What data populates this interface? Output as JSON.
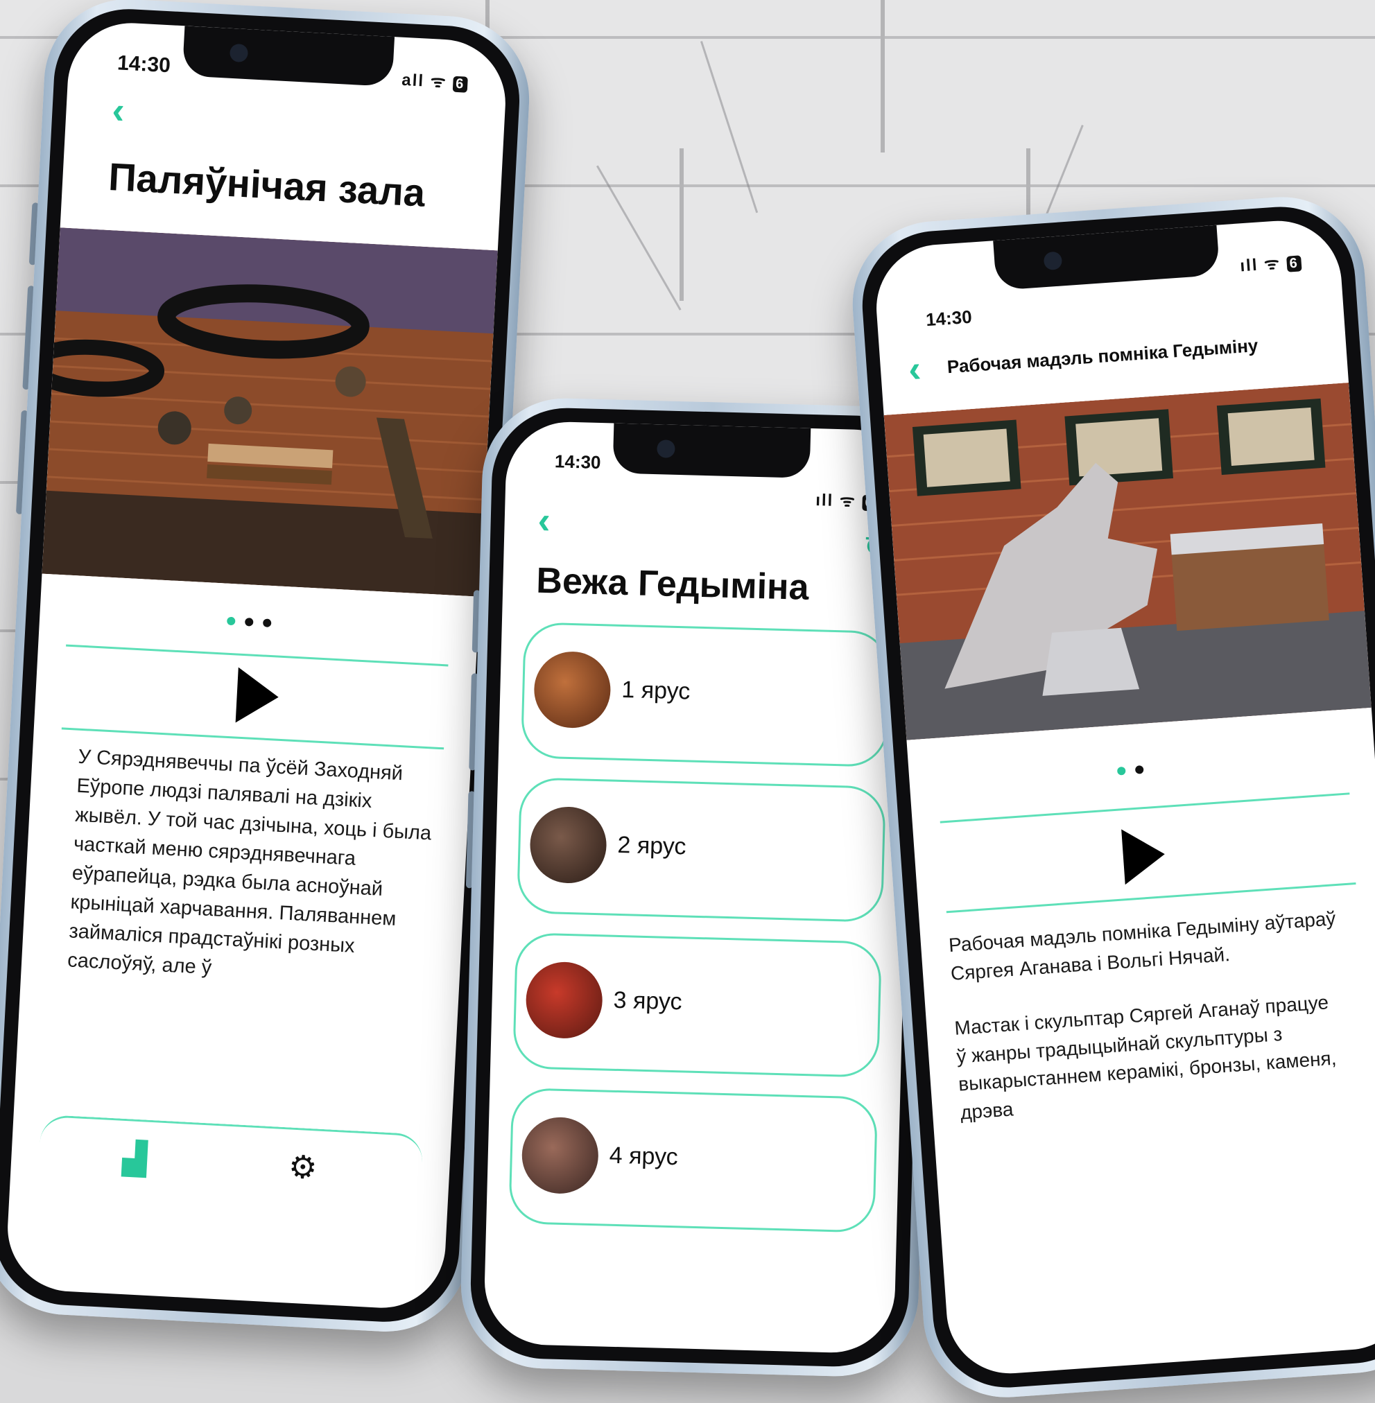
{
  "phones": {
    "left": {
      "time": "14:30",
      "status": "all ᯤ",
      "battery": "6",
      "title": "Паляўнічая зала",
      "description": "У Сярэднявеччы па ўсёй Заходняй Еўропе людзі палявалі на дзікіх жывёл. У той час дзічына, хоць і была часткай меню сярэднявечнага еўрапейца, рэдка была асноўнай крыніцай харчавання. Паляваннем займаліся прадстаўнікі розных саслоўяў, але ў",
      "tabs": [
        {
          "icon": "museum-icon"
        },
        {
          "icon": "gear-icon"
        }
      ]
    },
    "middle": {
      "time": "14:30",
      "status": "ıll ᯤ",
      "battery": "6",
      "title": "Вежа Гедыміна",
      "tiers": [
        {
          "label": "1 ярус"
        },
        {
          "label": "2 ярус"
        },
        {
          "label": "3 ярус"
        },
        {
          "label": "4 ярус"
        }
      ]
    },
    "right": {
      "time": "14:30",
      "status": "ıll ᯤ",
      "battery": "6",
      "title": "Рабочая мадэль помніка Гедыміну",
      "description_1": "Рабочая мадэль помніка Гедыміну аўтараў Сяргея Аганава і Вольгі Нячай.",
      "description_2": "Мастак і скульптар Сяргей Аганаў працуе ў жанры традыцыйнай скульптуры з выкарыстаннем керамікі, бронзы, каменя, дрэва"
    }
  },
  "colors": {
    "accent": "#28c79a",
    "divider": "#5ee0b8"
  }
}
